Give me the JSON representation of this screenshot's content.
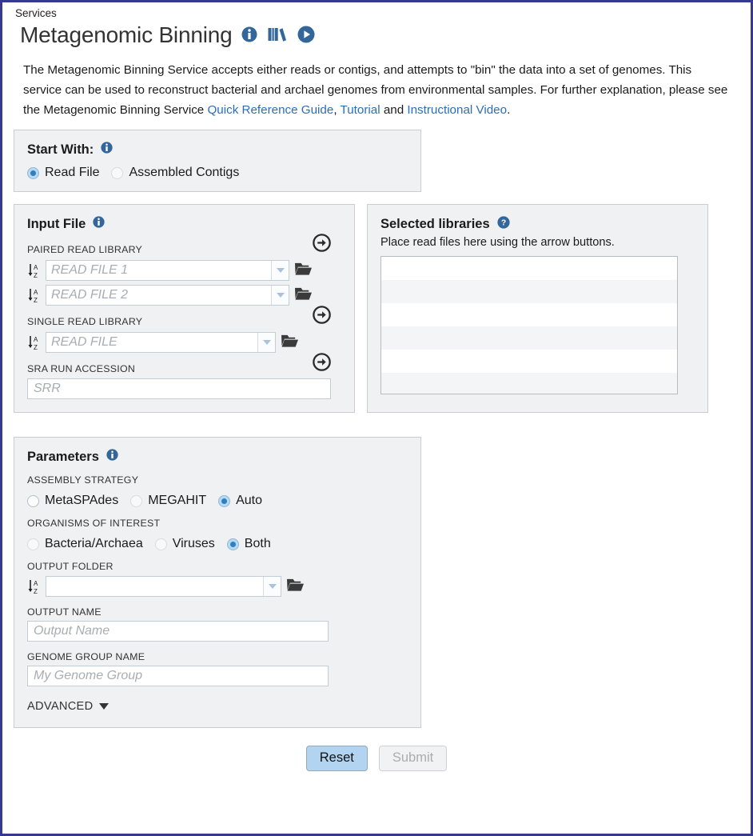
{
  "breadcrumb": "Services",
  "header": {
    "title": "Metagenomic Binning",
    "icons": [
      {
        "name": "info-circle-icon",
        "glyph": "i"
      },
      {
        "name": "books-library-icon",
        "glyph": "books"
      },
      {
        "name": "play-video-icon",
        "glyph": "play"
      }
    ]
  },
  "description": {
    "part1": "The Metagenomic Binning Service accepts either reads or contigs, and attempts to \"bin\" the data into a set of genomes. This service can be used to reconstruct bacterial and archael genomes from environmental samples. For further explanation, please see the Metagenomic Binning Service ",
    "link1": "Quick Reference Guide",
    "sep1": ", ",
    "link2": "Tutorial",
    "sep2": " and ",
    "link3": "Instructional Video",
    "end": "."
  },
  "start_with": {
    "title": "Start With:",
    "options": [
      {
        "label": "Read File",
        "checked": true
      },
      {
        "label": "Assembled Contigs",
        "checked": false
      }
    ]
  },
  "input_file": {
    "title": "Input File",
    "paired_label": "PAIRED READ LIBRARY",
    "read_file_1_placeholder": "READ FILE 1",
    "read_file_2_placeholder": "READ FILE 2",
    "single_label": "SINGLE READ LIBRARY",
    "read_file_placeholder": "READ FILE",
    "sra_label": "SRA RUN ACCESSION",
    "sra_placeholder": "SRR"
  },
  "selected_libraries": {
    "title": "Selected libraries",
    "hint": "Place read files here using the arrow buttons.",
    "rows": [
      "",
      "",
      "",
      "",
      "",
      ""
    ]
  },
  "parameters": {
    "title": "Parameters",
    "assembly_strategy_label": "ASSEMBLY STRATEGY",
    "assembly_options": [
      {
        "label": "MetaSPAdes",
        "checked": false
      },
      {
        "label": "MEGAHIT",
        "checked": false
      },
      {
        "label": "Auto",
        "checked": true
      }
    ],
    "organisms_label": "ORGANISMS OF INTEREST",
    "organism_options": [
      {
        "label": "Bacteria/Archaea",
        "checked": false
      },
      {
        "label": "Viruses",
        "checked": false
      },
      {
        "label": "Both",
        "checked": true
      }
    ],
    "output_folder_label": "OUTPUT FOLDER",
    "output_folder_value": "",
    "output_name_label": "OUTPUT NAME",
    "output_name_placeholder": "Output Name",
    "genome_group_label": "GENOME GROUP NAME",
    "genome_group_placeholder": "My Genome Group",
    "advanced_label": "ADVANCED"
  },
  "footer": {
    "reset_label": "Reset",
    "submit_label": "Submit"
  },
  "colors": {
    "frame_border": "#363a8c",
    "panel_bg": "#eff1f2",
    "panel_border": "#c9cdd0",
    "accent_blue": "#2a6ebb",
    "icon_blue": "#336699",
    "reset_bg": "#b3d4f0",
    "submit_disabled_text": "#a9adb0"
  }
}
